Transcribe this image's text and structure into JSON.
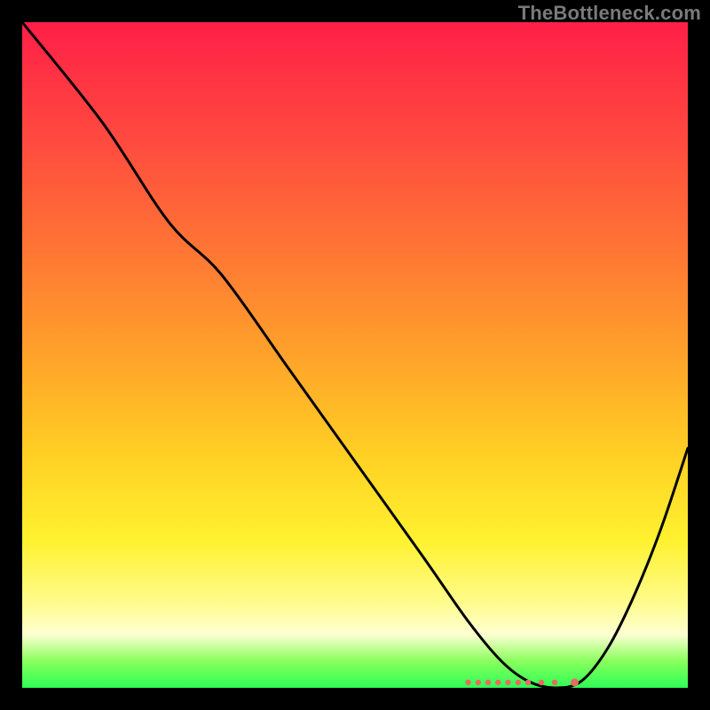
{
  "watermark": "TheBottleneck.com",
  "chart_data": {
    "type": "line",
    "title": "",
    "xlabel": "",
    "ylabel": "",
    "xlim": [
      0,
      100
    ],
    "ylim": [
      0,
      100
    ],
    "grid": false,
    "legend": false,
    "series": [
      {
        "name": "bottleneck-curve",
        "x": [
          0,
          12,
          22,
          30,
          40,
          50,
          60,
          67,
          72,
          76,
          80,
          84,
          88,
          92,
          96,
          100
        ],
        "values": [
          100,
          85,
          70,
          62,
          48,
          34,
          20,
          10,
          4,
          1,
          0,
          1,
          6,
          14,
          24,
          36
        ]
      }
    ],
    "floor_markers": {
      "name": "optimal-zone-dots",
      "x": [
        67,
        68.5,
        70,
        71.5,
        73,
        74.5,
        76,
        78,
        80,
        83
      ],
      "y": [
        0.8,
        0.8,
        0.8,
        0.8,
        0.8,
        0.8,
        0.8,
        0.8,
        0.8,
        0.8
      ],
      "color": "#e86a62"
    },
    "background_gradient": {
      "stops": [
        {
          "pos": 0.0,
          "color": "#ff1f47"
        },
        {
          "pos": 0.18,
          "color": "#ff4b3f"
        },
        {
          "pos": 0.36,
          "color": "#ff7a33"
        },
        {
          "pos": 0.52,
          "color": "#ffa829"
        },
        {
          "pos": 0.66,
          "color": "#ffd324"
        },
        {
          "pos": 0.78,
          "color": "#fff230"
        },
        {
          "pos": 0.87,
          "color": "#fffb8a"
        },
        {
          "pos": 0.92,
          "color": "#fdffd2"
        },
        {
          "pos": 0.96,
          "color": "#89ff5c"
        },
        {
          "pos": 1.0,
          "color": "#2dff57"
        }
      ]
    }
  }
}
